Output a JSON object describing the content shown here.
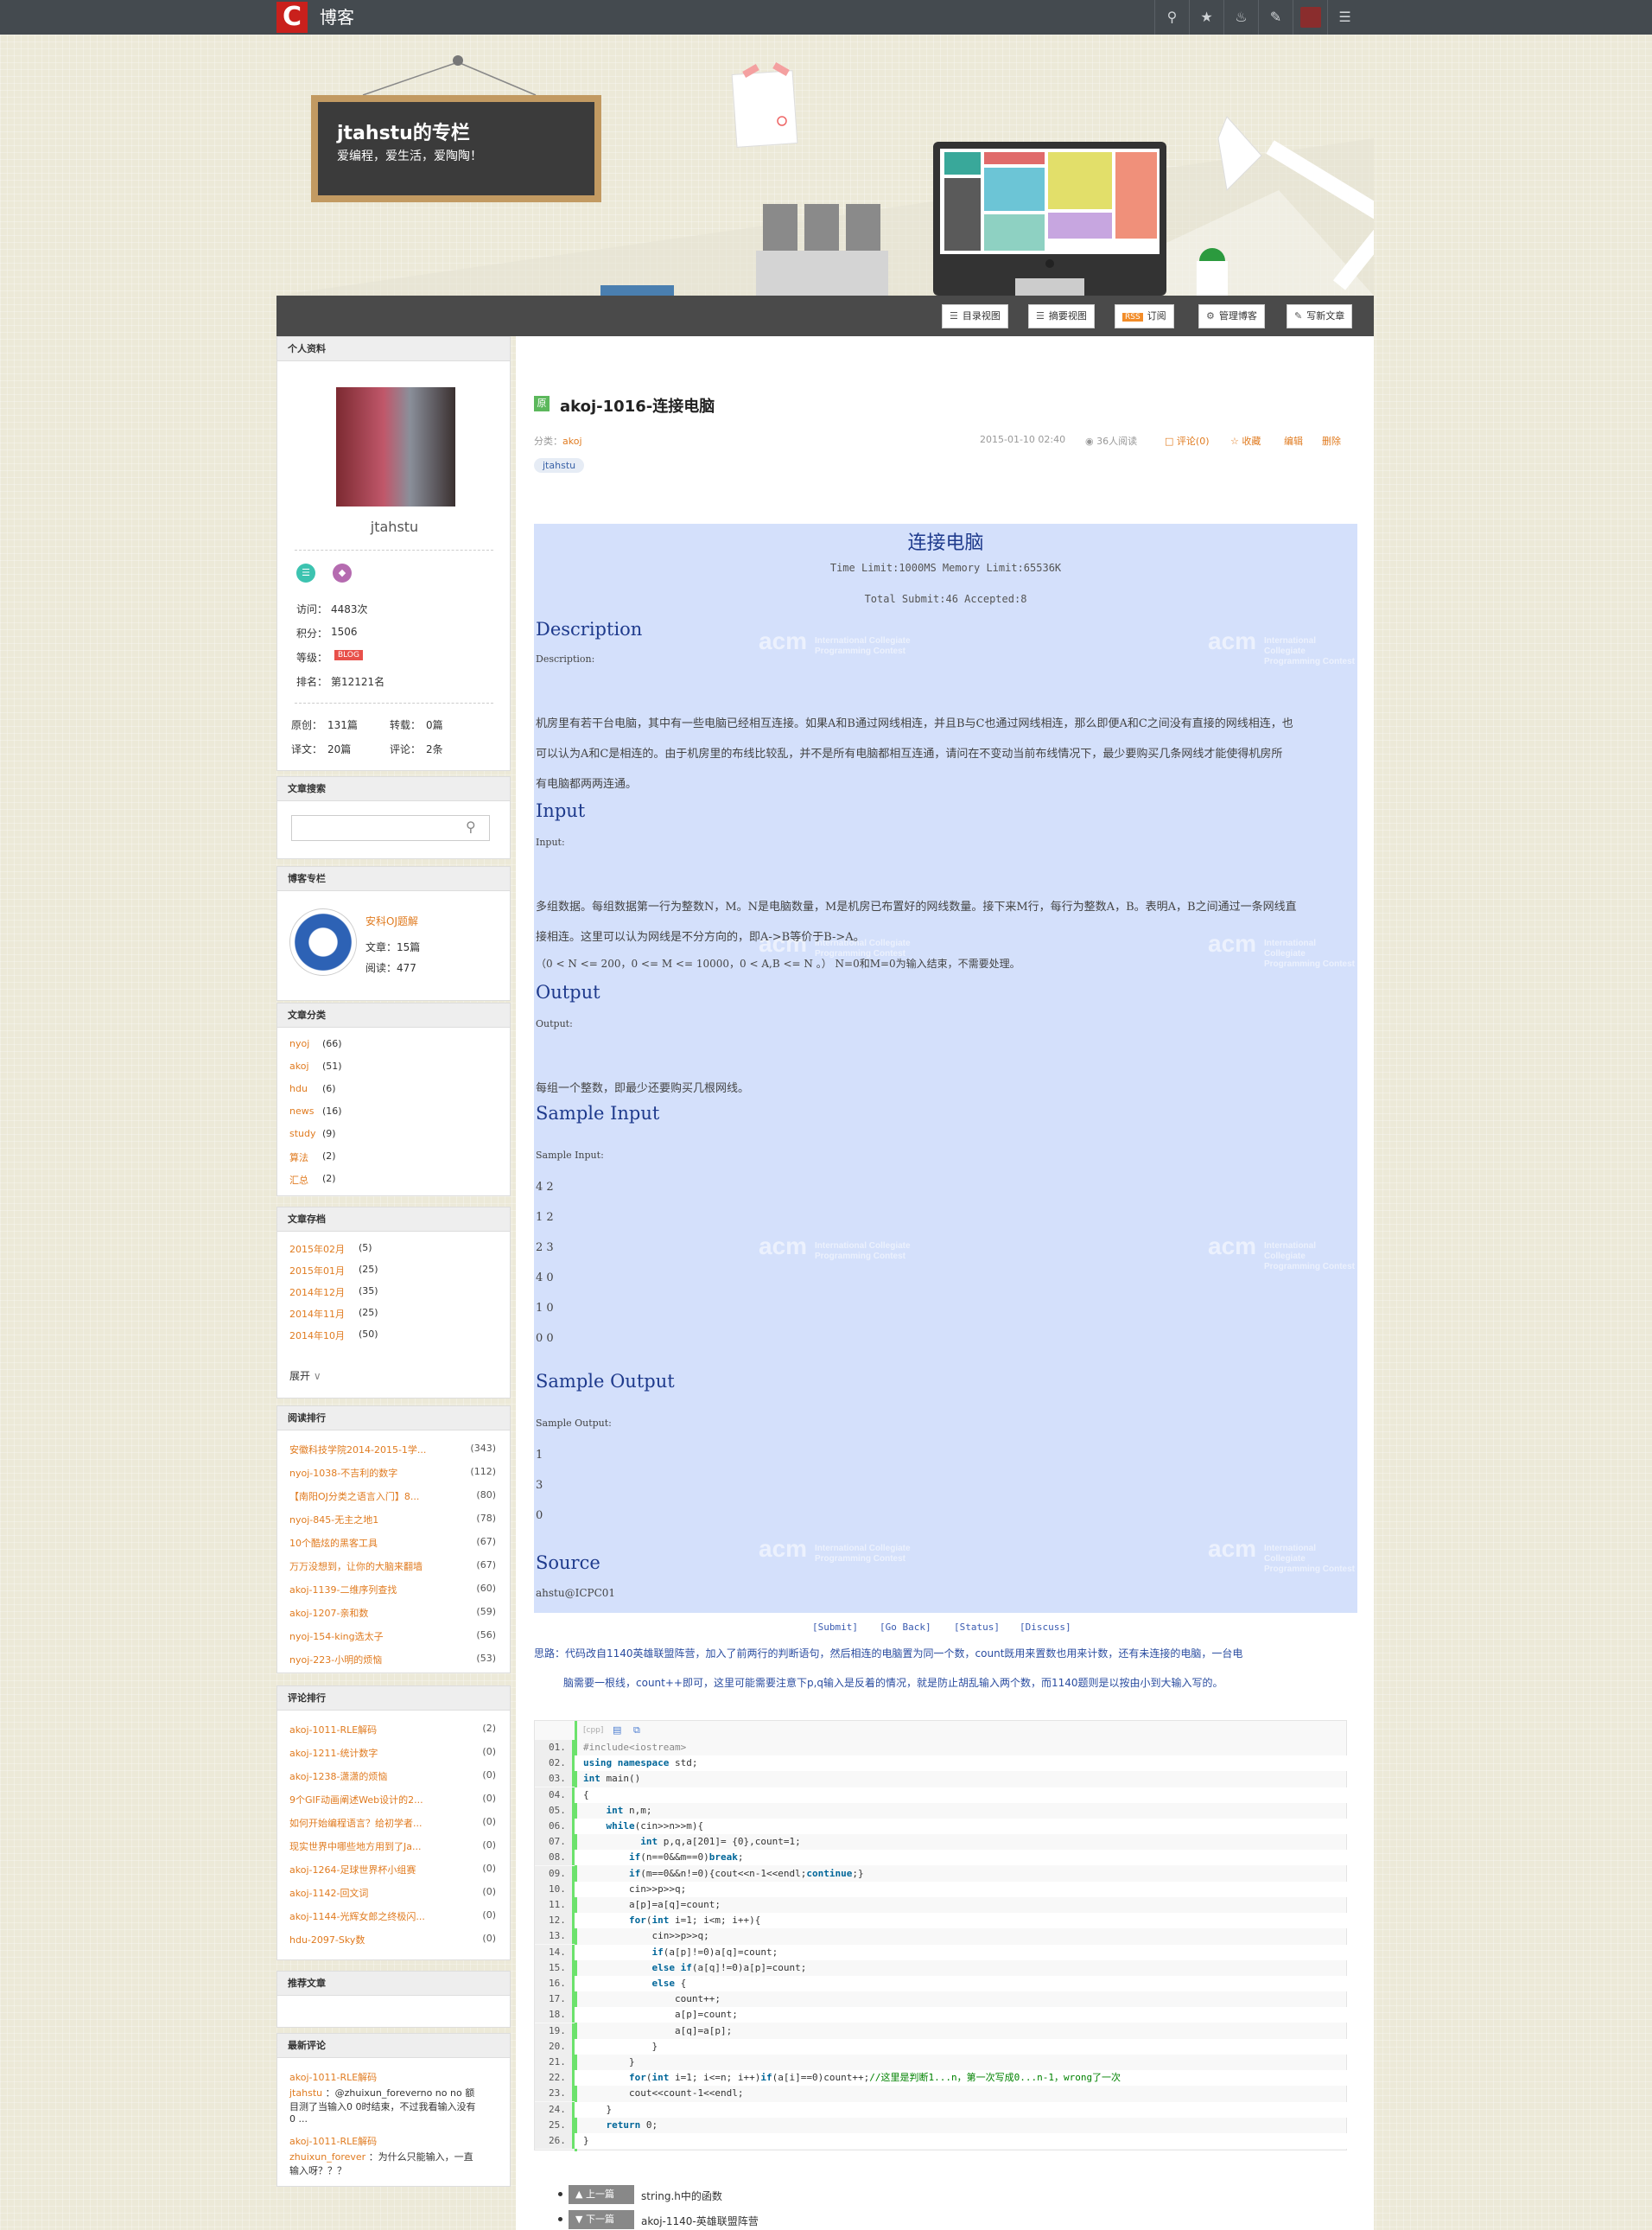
{
  "topbar": {
    "logo": "C",
    "brand": "博客",
    "icons": [
      "search-icon",
      "star-icon",
      "bell-icon",
      "edit-icon",
      "avatar",
      "menu-icon"
    ]
  },
  "header": {
    "title": "jtahstu的专栏",
    "subtitle": "爱编程，爱生活，爱陶陶！"
  },
  "header_buttons": [
    {
      "icon": "list-icon",
      "label": "目录视图"
    },
    {
      "icon": "summary-icon",
      "label": "摘要视图"
    },
    {
      "icon": "rss-icon",
      "label": "订阅"
    },
    {
      "icon": "gear-icon",
      "label": "管理博客"
    },
    {
      "icon": "write-icon",
      "label": "写新文章"
    }
  ],
  "profile": {
    "section_title": "个人资料",
    "username": "jtahstu",
    "visits_label": "访问：",
    "visits": "4483次",
    "points_label": "积分：",
    "points": "1506",
    "level_label": "等级：",
    "level_badge": "BLOG",
    "rank_label": "排名：",
    "rank": "第12121名",
    "original_label": "原创：",
    "original": "131篇",
    "repost_label": "转载：",
    "repost": "0篇",
    "translation_label": "译文：",
    "translation": "20篇",
    "comments_label": "评论：",
    "comments": "2条"
  },
  "search": {
    "section_title": "文章搜索",
    "placeholder": ""
  },
  "column": {
    "section_title": "博客专栏",
    "name": "安科OJ题解",
    "articles": "文章：15篇",
    "reads": "阅读：477"
  },
  "categories": {
    "section_title": "文章分类",
    "items": [
      {
        "name": "nyoj",
        "count": "(66)"
      },
      {
        "name": "akoj",
        "count": "(51)"
      },
      {
        "name": "hdu",
        "count": "(6)"
      },
      {
        "name": "news",
        "count": "(16)"
      },
      {
        "name": "study",
        "count": "(9)"
      },
      {
        "name": "算法",
        "count": "(2)"
      },
      {
        "name": "汇总",
        "count": "(2)"
      }
    ]
  },
  "archive": {
    "section_title": "文章存档",
    "items": [
      {
        "name": "2015年02月",
        "count": "(5)"
      },
      {
        "name": "2015年01月",
        "count": "(25)"
      },
      {
        "name": "2014年12月",
        "count": "(35)"
      },
      {
        "name": "2014年11月",
        "count": "(25)"
      },
      {
        "name": "2014年10月",
        "count": "(50)"
      }
    ],
    "expand": "展开"
  },
  "reading_rank": {
    "section_title": "阅读排行",
    "items": [
      {
        "name": "安徽科技学院2014-2015-1学...",
        "count": "(343)"
      },
      {
        "name": "nyoj-1038-不吉利的数字",
        "count": "(112)"
      },
      {
        "name": "【南阳OJ分类之语言入门】8...",
        "count": "(80)"
      },
      {
        "name": "nyoj-845-无主之地1",
        "count": "(78)"
      },
      {
        "name": "10个酷炫的黑客工具",
        "count": "(67)"
      },
      {
        "name": "万万没想到，让你的大脑来翻墙",
        "count": "(67)"
      },
      {
        "name": "akoj-1139-二维序列查找",
        "count": "(60)"
      },
      {
        "name": "akoj-1207-亲和数",
        "count": "(59)"
      },
      {
        "name": "nyoj-154-king选太子",
        "count": "(56)"
      },
      {
        "name": "nyoj-223-小明的烦恼",
        "count": "(53)"
      }
    ]
  },
  "comment_rank": {
    "section_title": "评论排行",
    "items": [
      {
        "name": "akoj-1011-RLE解码",
        "count": "(2)"
      },
      {
        "name": "akoj-1211-统计数字",
        "count": "(0)"
      },
      {
        "name": "akoj-1238-潇潇的烦恼",
        "count": "(0)"
      },
      {
        "name": "9个GIF动画阐述Web设计的2...",
        "count": "(0)"
      },
      {
        "name": "如何开始编程语言？给初学者...",
        "count": "(0)"
      },
      {
        "name": "现实世界中哪些地方用到了Ja...",
        "count": "(0)"
      },
      {
        "name": "akoj-1264-足球世界杯小组赛",
        "count": "(0)"
      },
      {
        "name": "akoj-1142-回文词",
        "count": "(0)"
      },
      {
        "name": "akoj-1144-光辉女郎之终极闪...",
        "count": "(0)"
      },
      {
        "name": "hdu-2097-Sky数",
        "count": "(0)"
      }
    ]
  },
  "recommended": {
    "section_title": "推荐文章"
  },
  "latest_comments": {
    "section_title": "最新评论",
    "items": [
      {
        "post": "akoj-1011-RLE解码",
        "author": "jtahstu",
        "text1": "：@zhuixun_foreverno no no 额",
        "text2": "目测了当输入0 0时结束，不过我看输入没有",
        "text3": "0 ..."
      },
      {
        "post": "akoj-1011-RLE解码",
        "author": "zhuixun_forever",
        "text1": "：为什么只能输入，一直",
        "text2": "输入呀？？？"
      }
    ]
  },
  "article": {
    "badge": "原",
    "title": "akoj-1016-连接电脑",
    "category_label": "分类：",
    "category": "akoj",
    "date": "2015-01-10 02:40",
    "reads": "36人阅读",
    "comments": "评论(0)",
    "favorite": "收藏",
    "edit": "编辑",
    "delete": "删除",
    "tag": "jtahstu"
  },
  "problem": {
    "title": "连接电脑",
    "limits": "Time Limit:1000MS  Memory Limit:65536K",
    "submits": "Total Submit:46 Accepted:8",
    "desc_h": "Description",
    "desc_label": "Description:",
    "desc_1": "机房里有若干台电脑，其中有一些电脑已经相互连接。如果A和B通过网线相连，并且B与C也通过网线相连，那么即便A和C之间没有直接的网线相连，也",
    "desc_2": "可以认为A和C是相连的。由于机房里的布线比较乱，并不是所有电脑都相互连通，请问在不变动当前布线情况下，最少要购买几条网线才能使得机房所",
    "desc_3": "有电脑都两两连通。",
    "input_h": "Input",
    "input_label": "Input:",
    "input_1": "多组数据。每组数据第一行为整数N，M。N是电脑数量，M是机房已布置好的网线数量。接下来M行，每行为整数A，B。表明A，B之间通过一条网线直",
    "input_2": "接相连。这里可以认为网线是不分方向的，即A->B等价于B->A。",
    "input_3": "（0 < N <= 200，0 <= M <= 10000，0 < A,B <= N 。） N=0和M=0为输入结束，不需要处理。",
    "output_h": "Output",
    "output_label": "Output:",
    "output_1": "每组一个整数，即最少还要购买几根网线。",
    "sin_h": "Sample Input",
    "sin_label": "Sample Input:",
    "sin": [
      "4 2",
      "1 2",
      "2 3",
      "4 0",
      "1 0",
      "0 0"
    ],
    "sout_h": "Sample Output",
    "sout_label": "Sample Output:",
    "sout": [
      "1",
      "3",
      "0"
    ],
    "source_h": "Source",
    "source": "ahstu@ICPC01",
    "wm1": "acm",
    "wm2": "International Collegiate Programming Contest",
    "links": [
      "[Submit]",
      "[Go Back]",
      "[Status]",
      "[Discuss]"
    ]
  },
  "thoughts": {
    "line1": "思路：代码改自1140英雄联盟阵营，加入了前两行的判断语句，然后相连的电脑置为同一个数，count既用来置数也用来计数，还有未连接的电脑，一台电",
    "line2": "脑需要一根线，count++即可，这里可能需要注意下p,q输入是反着的情况，就是防止胡乱输入两个数，而1140题则是以按由小到大输入写的。"
  },
  "code": {
    "tag": "[cpp]",
    "lines": [
      [
        "01.",
        "#include<iostream>"
      ],
      [
        "02.",
        "using namespace std;"
      ],
      [
        "03.",
        "int main()"
      ],
      [
        "04.",
        "{"
      ],
      [
        "05.",
        "    int n,m;"
      ],
      [
        "06.",
        "    while(cin>>n>>m){"
      ],
      [
        "07.",
        "          int p,q,a[201]= {0},count=1;"
      ],
      [
        "08.",
        "        if(n==0&&m==0)break;"
      ],
      [
        "09.",
        "        if(m==0&&n!=0){cout<<n-1<<endl;continue;}"
      ],
      [
        "10.",
        "        cin>>p>>q;"
      ],
      [
        "11.",
        "        a[p]=a[q]=count;"
      ],
      [
        "12.",
        "        for(int i=1; i<m; i++){"
      ],
      [
        "13.",
        "            cin>>p>>q;"
      ],
      [
        "14.",
        "            if(a[p]!=0)a[q]=count;"
      ],
      [
        "15.",
        "            else if(a[q]!=0)a[p]=count;"
      ],
      [
        "16.",
        "            else {"
      ],
      [
        "17.",
        "                count++;"
      ],
      [
        "18.",
        "                a[p]=count;"
      ],
      [
        "19.",
        "                a[q]=a[p];"
      ],
      [
        "20.",
        "            }"
      ],
      [
        "21.",
        "        }"
      ],
      [
        "22.",
        "        for(int i=1; i<=n; i++)if(a[i]==0)count++;//这里是判断1...n，第一次写成0...n-1，wrong了一次"
      ],
      [
        "23.",
        "        cout<<count-1<<endl;"
      ],
      [
        "24.",
        "    }"
      ],
      [
        "25.",
        "    return 0;"
      ],
      [
        "26.",
        "}"
      ]
    ]
  },
  "post_nav": {
    "prev_label": "上一篇",
    "prev": "string.h中的函数",
    "next_label": "下一篇",
    "next": "akoj-1140-英雄联盟阵营"
  }
}
